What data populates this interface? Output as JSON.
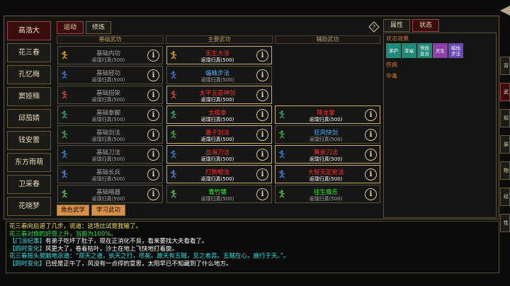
{
  "characters": [
    "高浩大",
    "花三春",
    "孔忆梅",
    "窦娅楠",
    "邱茄婧",
    "钱安蕾",
    "东方雨萌",
    "卫采春",
    "花晓梦"
  ],
  "tabs": {
    "yundong": "运动",
    "xiulian": "修炼"
  },
  "columns": {
    "basic": "基础武功",
    "main": "主要武功",
    "aux": "辅助武功"
  },
  "info_glyph": "i",
  "basic_skills": [
    {
      "name": "基础内功",
      "desc": "返璞归真(500)"
    },
    {
      "name": "基础轻功",
      "desc": "返璞归真(500)"
    },
    {
      "name": "基础招架",
      "desc": "返璞归真(500)"
    },
    {
      "name": "基础拳脚",
      "desc": "返璞归真(500)"
    },
    {
      "name": "基础剑法",
      "desc": "返璞归真(500)"
    },
    {
      "name": "基础刀法",
      "desc": "返璞归真(500)"
    },
    {
      "name": "基础长兵",
      "desc": "返璞归真(500)"
    },
    {
      "name": "基础暗器",
      "desc": "返璞归真(500)"
    }
  ],
  "main_skills": [
    {
      "name": "无生大法",
      "desc": "返璞归真(500)"
    },
    {
      "name": "蝠蛛步法",
      "desc": "返璞归真(500)"
    },
    {
      "name": "太平五岳神剑",
      "desc": "返璞归真(500)"
    },
    {
      "name": "太极拳",
      "desc": "返璞归真(500)"
    },
    {
      "name": "墨子剑法",
      "desc": "返璞归真(500)"
    },
    {
      "name": "血海刀法",
      "desc": "返璞归真(500)"
    },
    {
      "name": "打狗棍法",
      "desc": "返璞归真(500)"
    },
    {
      "name": "青竹镖",
      "desc": "返璞归真(500)"
    }
  ],
  "aux_skills": [
    {
      "name": "降龙掌",
      "desc": "返璞归真(500)"
    },
    {
      "name": "狂风快剑",
      "desc": "返璞归真(500)"
    },
    {
      "name": "黄泉刀法",
      "desc": "返璞归真(500)"
    },
    {
      "name": "大智无定枪法",
      "desc": "返璞归真(500)"
    },
    {
      "name": "往生极乐",
      "desc": "返璞归真(500)"
    }
  ],
  "bottom_buttons": {
    "role": "角色武学",
    "learn": "学习武功"
  },
  "status_tabs": {
    "attr": "属性",
    "status": "状态"
  },
  "status": {
    "effects_label": "状态效果",
    "badges": [
      {
        "text": "茅庐",
        "color": "#1f8a78"
      },
      {
        "text": "幸福",
        "color": "#1f8a78"
      },
      {
        "text": "快技 息合",
        "color": "#1f8a78"
      },
      {
        "text": "天生",
        "color": "#8a40a8"
      },
      {
        "text": "蜡烛 步法",
        "color": "#6a48b8"
      }
    ],
    "injury_label": "伤病",
    "poison_label": "中毒"
  },
  "side_tabs": [
    "背",
    "武",
    "知",
    "装",
    "物",
    "经",
    "性"
  ],
  "log": [
    {
      "color": "yellow",
      "text": "花三春向后退了几步，说道：这场比试是我输了。"
    },
    {
      "color": "green",
      "text": "花三春对你的好感上升，当前为100%。"
    },
    {
      "color": "white",
      "prefix": "【门派纪事】",
      "text": "有弟子吃坏了肚子，现在正消化不良，看来要找大夫看看了。"
    },
    {
      "color": "white",
      "prefix": "【四时变化】",
      "text": "风更大了，卷着枯叶，沙土在地上飞快地打着旋。"
    },
    {
      "color": "cyan",
      "text": "花三春摇头晃脑地念道：“观天之道，执天之行，尽矣。故天有五贼，见之者昌。五贼在心，施行于天。”。"
    },
    {
      "color": "white",
      "prefix": "【四时变化】",
      "text": "已经是正午了，风没有一点停的意思，太阳早已不知藏到了什么地方。"
    }
  ]
}
